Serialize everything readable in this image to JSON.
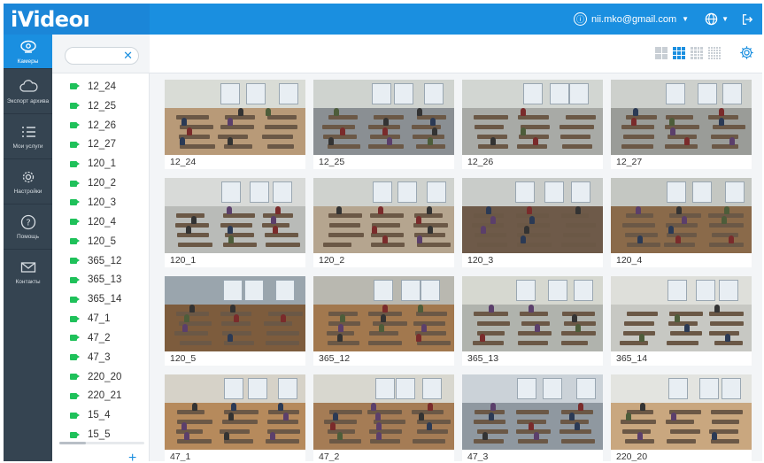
{
  "app": {
    "logo": "iVideoı"
  },
  "topbar": {
    "user_email": "nii.mko@gmail.com",
    "user_icon": "user-icon",
    "language_icon": "globe-icon",
    "logout_icon": "logout-icon"
  },
  "nav": [
    {
      "label": "Камеры",
      "icon": "camera-icon",
      "active": true
    },
    {
      "label": "Экспорт архива",
      "icon": "cloud-icon",
      "active": false
    },
    {
      "label": "Мои услуги",
      "icon": "list-icon",
      "active": false
    },
    {
      "label": "Настройки",
      "icon": "gear-icon",
      "active": false
    },
    {
      "label": "Помощь",
      "icon": "help-icon",
      "active": false
    },
    {
      "label": "Контакты",
      "icon": "mail-icon",
      "active": false
    }
  ],
  "search": {
    "placeholder": "",
    "value": "",
    "clear_icon": "close-icon"
  },
  "cameras": [
    "12_24",
    "12_25",
    "12_26",
    "12_27",
    "120_1",
    "120_2",
    "120_3",
    "120_4",
    "120_5",
    "365_12",
    "365_13",
    "365_14",
    "47_1",
    "47_2",
    "47_3",
    "220_20",
    "220_21",
    "15_4",
    "15_5"
  ],
  "list_add_icon": "plus-icon",
  "toolbar": {
    "layouts": [
      "grid-2x2-icon",
      "grid-4x4-icon",
      "grid-5x5-icon",
      "grid-6x6-icon"
    ],
    "active_layout": 1,
    "settings_icon": "settings-icon"
  },
  "tiles": [
    {
      "label": "12_24",
      "wall": "#d9dcd6",
      "floor": "#b89a78"
    },
    {
      "label": "12_25",
      "wall": "#cfd3cf",
      "floor": "#8a8f93"
    },
    {
      "label": "12_26",
      "wall": "#d2d6d2",
      "floor": "#a8aaa6"
    },
    {
      "label": "12_27",
      "wall": "#cdd0cc",
      "floor": "#9a9c98"
    },
    {
      "label": "120_1",
      "wall": "#d8dad8",
      "floor": "#b9bbb8"
    },
    {
      "label": "120_2",
      "wall": "#cfd2ce",
      "floor": "#b5a58f"
    },
    {
      "label": "120_3",
      "wall": "#c9ccc9",
      "floor": "#6e5a49"
    },
    {
      "label": "120_4",
      "wall": "#c4c7c2",
      "floor": "#8a6a4a"
    },
    {
      "label": "120_5",
      "wall": "#9aa5ad",
      "floor": "#7d5c3d"
    },
    {
      "label": "365_12",
      "wall": "#b9b8b0",
      "floor": "#a2784e"
    },
    {
      "label": "365_13",
      "wall": "#d6d8d0",
      "floor": "#b0b3ad"
    },
    {
      "label": "365_14",
      "wall": "#dedfda",
      "floor": "#c7c8c3"
    },
    {
      "label": "47_1",
      "wall": "#d6d2c8",
      "floor": "#b68a5c"
    },
    {
      "label": "47_2",
      "wall": "#d8d7cf",
      "floor": "#a57c55"
    },
    {
      "label": "47_3",
      "wall": "#cbd2d8",
      "floor": "#8f98a0"
    },
    {
      "label": "220_20",
      "wall": "#e3e4e0",
      "floor": "#c9a77f"
    }
  ],
  "colors": {
    "accent": "#1a8fe0",
    "nav_bg": "#354451",
    "online": "#1fc15a"
  }
}
